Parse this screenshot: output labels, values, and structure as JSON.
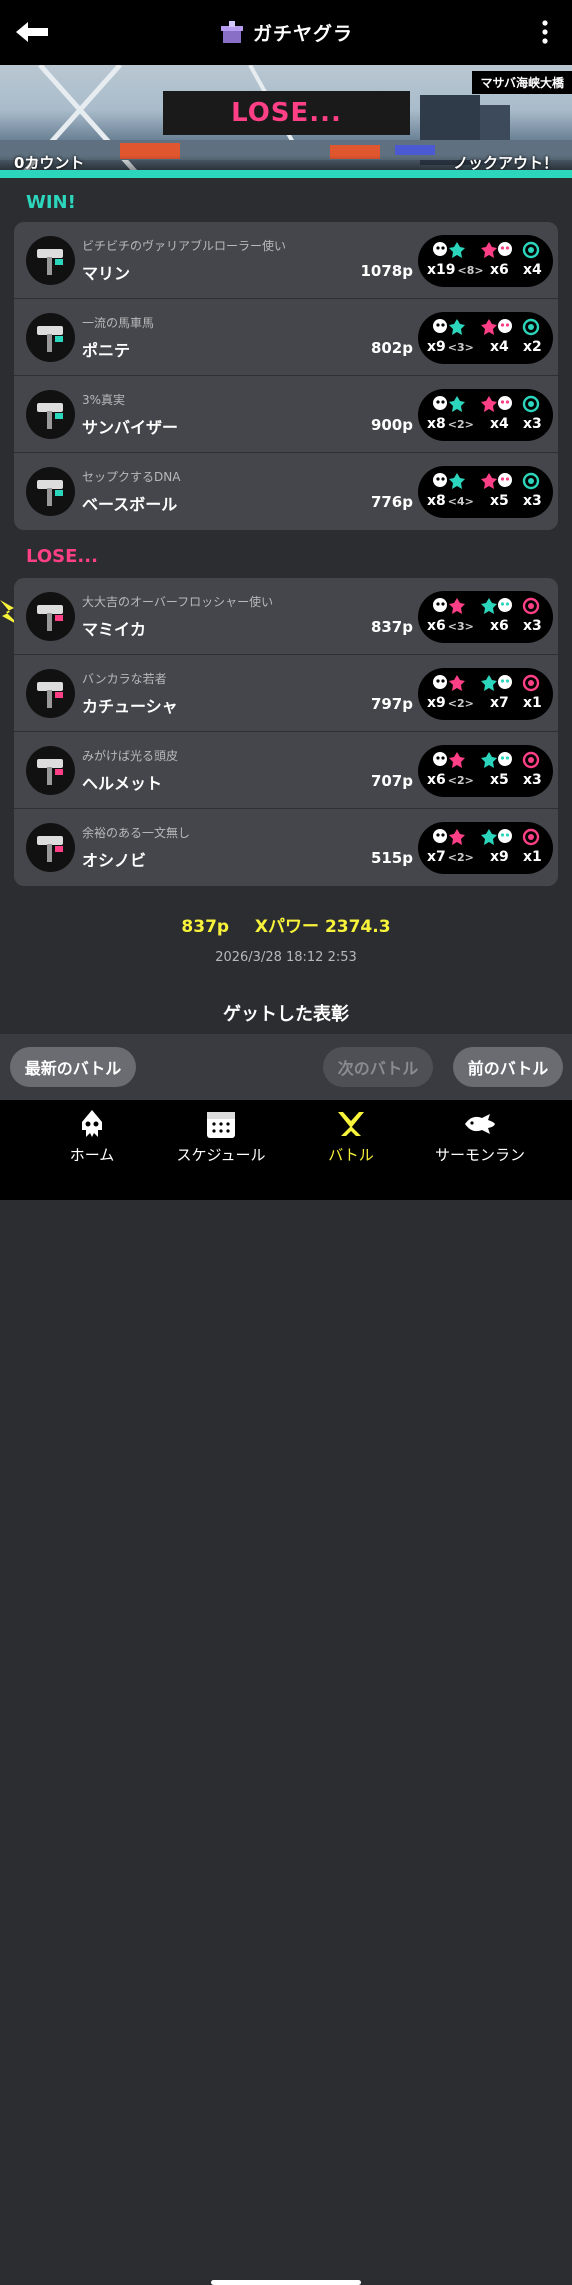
{
  "header": {
    "title": "ガチヤグラ"
  },
  "banner": {
    "stage": "マサバ海峡大橋",
    "result": "LOSE...",
    "count_left": "0カウント",
    "count_right": "ノックアウト！"
  },
  "colors": {
    "win": "#2cd6bd",
    "lose": "#ff3f86",
    "highlight": "#f7f23a"
  },
  "win": {
    "label": "WIN!",
    "players": [
      {
        "title": "ビチビチのヴァリアブルローラー使い",
        "name": "マリン",
        "points": "1078p",
        "kills": "x19",
        "assists": "<8>",
        "deaths": "x6",
        "special": "x4",
        "weapon_icon": "roller-icon"
      },
      {
        "title": "一流の馬車馬",
        "name": "ポニテ",
        "points": "802p",
        "kills": "x9",
        "assists": "<3>",
        "deaths": "x4",
        "special": "x2",
        "weapon_icon": "blaster-icon"
      },
      {
        "title": "3%真実",
        "name": "サンバイザー",
        "points": "900p",
        "kills": "x8",
        "assists": "<2>",
        "deaths": "x4",
        "special": "x3",
        "weapon_icon": "shooter-icon"
      },
      {
        "title": "セップクするDNA",
        "name": "ベースボール",
        "points": "776p",
        "kills": "x8",
        "assists": "<4>",
        "deaths": "x5",
        "special": "x3",
        "weapon_icon": "brella-icon"
      }
    ]
  },
  "lose": {
    "label": "LOSE...",
    "players": [
      {
        "title": "大大吉のオーバーフロッシャー使い",
        "name": "マミイカ",
        "points": "837p",
        "kills": "x6",
        "assists": "<3>",
        "deaths": "x6",
        "special": "x3",
        "weapon_icon": "slosher-icon"
      },
      {
        "title": "バンカラな若者",
        "name": "カチューシャ",
        "points": "797p",
        "kills": "x9",
        "assists": "<2>",
        "deaths": "x7",
        "special": "x1",
        "weapon_icon": "roller-icon"
      },
      {
        "title": "みがけば光る頭皮",
        "name": "ヘルメット",
        "points": "707p",
        "kills": "x6",
        "assists": "<2>",
        "deaths": "x5",
        "special": "x3",
        "weapon_icon": "charger-icon"
      },
      {
        "title": "余裕のある一文無し",
        "name": "オシノビ",
        "points": "515p",
        "kills": "x7",
        "assists": "<2>",
        "deaths": "x9",
        "special": "x1",
        "weapon_icon": "roller-icon"
      }
    ]
  },
  "summary": {
    "points": "837p",
    "xpower": "Xパワー 2374.3",
    "datetime": "2026/3/28 18:12 2:53"
  },
  "titles_heading": "ゲットした表彰",
  "nav_buttons": {
    "latest": "最新のバトル",
    "next": "次のバトル",
    "prev": "前のバトル"
  },
  "tabs": [
    {
      "label": "ホーム",
      "icon": "squid-icon"
    },
    {
      "label": "スケジュール",
      "icon": "calendar-icon"
    },
    {
      "label": "バトル",
      "icon": "battle-icon"
    },
    {
      "label": "サーモンラン",
      "icon": "salmon-icon"
    }
  ]
}
